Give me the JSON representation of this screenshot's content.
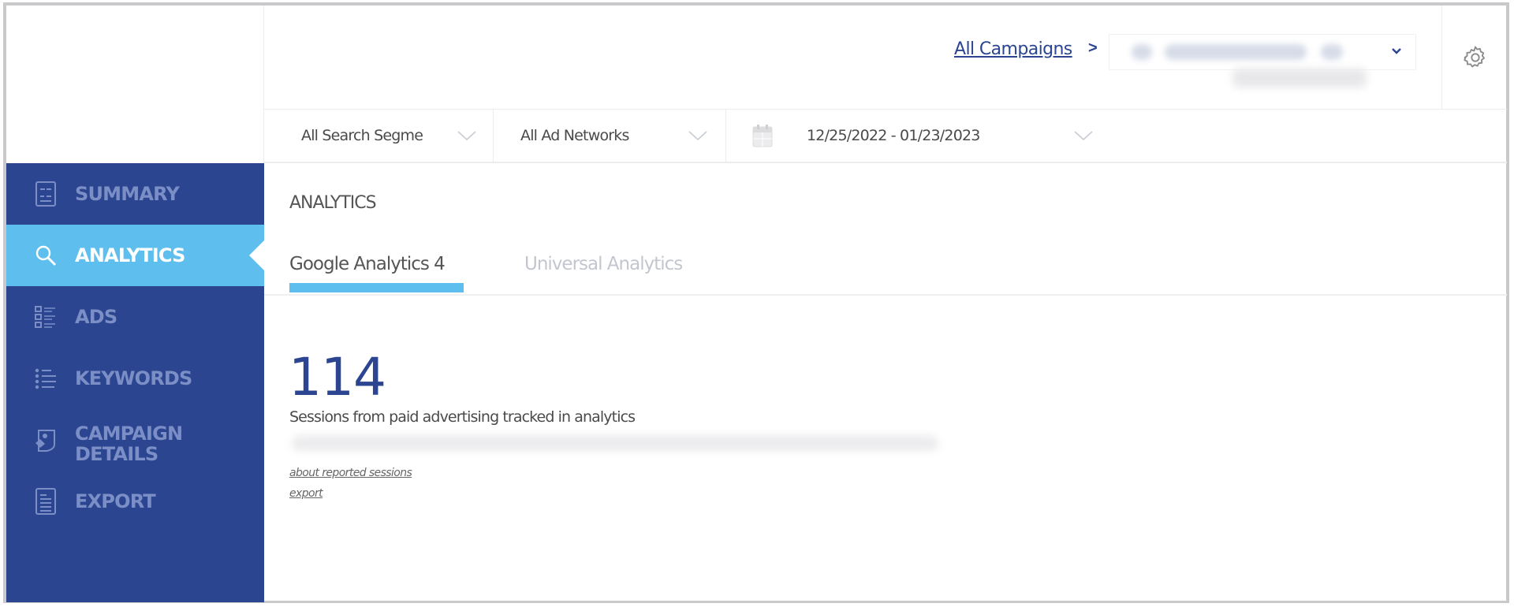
{
  "header": {
    "breadcrumb_link": "All Campaigns",
    "breadcrumb_separator": ">",
    "campaign_select": {
      "value_redacted": true
    },
    "settings_icon": "gear-icon"
  },
  "filters": [
    {
      "label": "All Search Segme",
      "icon": "chevron-down-icon"
    },
    {
      "label": "All Ad Networks",
      "icon": "chevron-down-icon"
    },
    {
      "label": "12/25/2022 - 01/23/2023",
      "leading_icon": "calendar-icon",
      "icon": "chevron-down-icon"
    }
  ],
  "sidebar": {
    "items": [
      {
        "label": "SUMMARY",
        "icon": "summary-report-icon",
        "active": false
      },
      {
        "label": "ANALYTICS",
        "icon": "search-icon",
        "active": true
      },
      {
        "label": "ADS",
        "icon": "ads-list-icon",
        "active": false
      },
      {
        "label": "KEYWORDS",
        "icon": "keywords-list-icon",
        "active": false
      },
      {
        "label": "CAMPAIGN",
        "label2": "DETAILS",
        "icon": "campaign-details-icon",
        "active": false
      },
      {
        "label": "EXPORT",
        "icon": "export-document-icon",
        "active": false
      }
    ]
  },
  "main": {
    "section_title": "ANALYTICS",
    "tabs": [
      {
        "label": "Google Analytics 4",
        "active": true
      },
      {
        "label": "Universal Analytics",
        "active": false
      }
    ],
    "metric": {
      "value": "114",
      "description": "Sessions from paid advertising tracked in analytics"
    },
    "links": {
      "about": "about reported sessions",
      "export": "export"
    }
  },
  "colors": {
    "brand_navy": "#2b4590",
    "accent_blue": "#5ebfef",
    "sidebar_inactive_text": "#7b8fc6"
  }
}
